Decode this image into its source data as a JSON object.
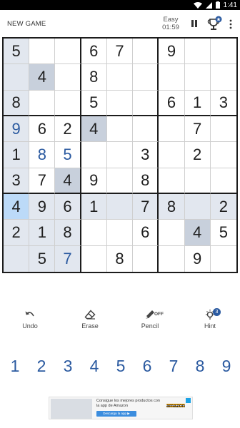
{
  "status": {
    "time": "1:41"
  },
  "header": {
    "new_game": "NEW GAME",
    "difficulty": "Easy",
    "timer": "01:59"
  },
  "board": {
    "cells": [
      [
        "5",
        "",
        "",
        "6",
        "7",
        "",
        "9",
        "",
        ""
      ],
      [
        "",
        "4",
        "",
        "8",
        "",
        "",
        "",
        "",
        ""
      ],
      [
        "8",
        "",
        "",
        "5",
        "",
        "",
        "6",
        "1",
        "3"
      ],
      [
        "9",
        "6",
        "2",
        "4",
        "",
        "",
        "",
        "7",
        ""
      ],
      [
        "1",
        "8",
        "5",
        "",
        "",
        "3",
        "",
        "2",
        ""
      ],
      [
        "3",
        "7",
        "4",
        "9",
        "",
        "8",
        "",
        "",
        ""
      ],
      [
        "4",
        "9",
        "6",
        "1",
        "",
        "7",
        "8",
        "",
        "2"
      ],
      [
        "2",
        "1",
        "8",
        "",
        "",
        "6",
        "",
        "4",
        "5"
      ],
      [
        "",
        "5",
        "7",
        "",
        "8",
        "",
        "",
        "9",
        ""
      ]
    ],
    "user_entered": [
      [
        3,
        0
      ],
      [
        4,
        1
      ],
      [
        4,
        2
      ],
      [
        8,
        2
      ]
    ],
    "selected": [
      6,
      0
    ],
    "highlight_number": "4",
    "colors": {
      "user_digit": "#2b5aa0",
      "highlight": "#e2e7ef",
      "same_number": "#c8d0dc",
      "selected": "#bcdaf8"
    }
  },
  "tools": {
    "undo": {
      "label": "Undo",
      "icon": "undo-icon"
    },
    "erase": {
      "label": "Erase",
      "icon": "eraser-icon"
    },
    "pencil": {
      "label": "Pencil",
      "state": "OFF",
      "icon": "pencil-icon"
    },
    "hint": {
      "label": "Hint",
      "count": "3",
      "icon": "lightbulb-icon"
    }
  },
  "numpad": [
    "1",
    "2",
    "3",
    "4",
    "5",
    "6",
    "7",
    "8",
    "9"
  ],
  "ad": {
    "text": "Consigue los mejores productos con la app de Amazon",
    "button": "Descarga la app ▶",
    "brand": "amazon"
  }
}
